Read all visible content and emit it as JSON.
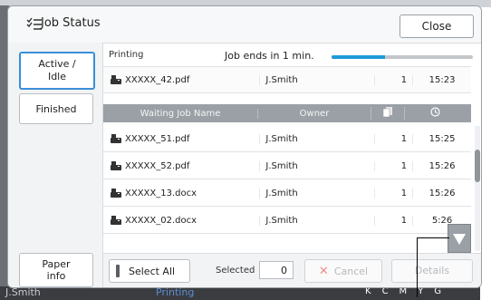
{
  "dialog": {
    "title": "Job Status",
    "close_label": "Close"
  },
  "sidebar": {
    "tabs": [
      {
        "label_line1": "Active /",
        "label_line2": "Idle"
      },
      {
        "label": "Finished"
      }
    ],
    "paper_info_line1": "Paper",
    "paper_info_line2": "info"
  },
  "printing": {
    "label": "Printing",
    "status_text": "Job ends in 1 min.",
    "progress_fraction": 0.38,
    "current_job": {
      "name": "XXXXX_42.pdf",
      "owner": "J.Smith",
      "pages": "1",
      "time": "15:23"
    }
  },
  "table": {
    "headers": {
      "name": "Waiting Job Name",
      "owner": "Owner"
    },
    "rows": [
      {
        "name": "XXXXX_51.pdf",
        "owner": "J.Smith",
        "pages": "1",
        "time": "15:25"
      },
      {
        "name": "XXXXX_52.pdf",
        "owner": "J.Smith",
        "pages": "1",
        "time": "15:26"
      },
      {
        "name": "XXXXX_13.docx",
        "owner": "J.Smith",
        "pages": "1",
        "time": "15:26"
      },
      {
        "name": "XXXXX_02.docx",
        "owner": "J.Smith",
        "pages": "1",
        "time": "5:26"
      }
    ]
  },
  "footer": {
    "select_all_label": "Select All",
    "selected_label": "Selected",
    "selected_count": "0",
    "cancel_label": "Cancel",
    "details_label": "Details"
  },
  "underlying": {
    "user": "J.Smith",
    "status": "Printing",
    "toner_labels": [
      "K",
      "C",
      "M",
      "Y",
      "G"
    ]
  },
  "colors": {
    "accent": "#3a8fd8",
    "progress": "#1e9bd6",
    "header_bg": "#9aa0a6",
    "cancel_icon": "#ee8d8d"
  }
}
